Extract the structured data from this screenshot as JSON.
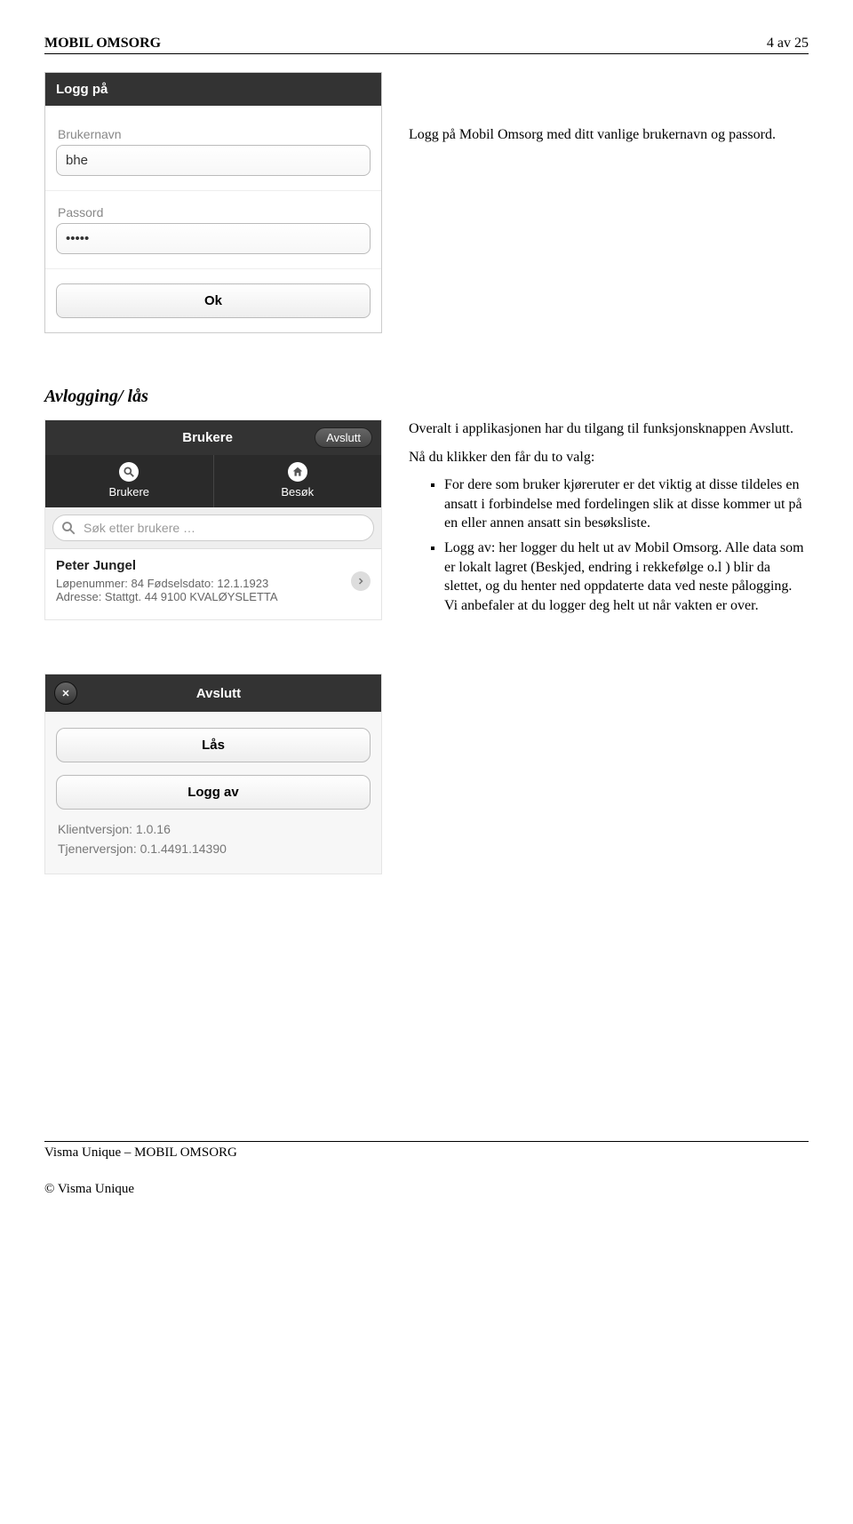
{
  "header": {
    "left": "MOBIL OMSORG",
    "right": "4 av 25"
  },
  "login": {
    "title": "Logg på",
    "username_label": "Brukernavn",
    "username_value": "bhe",
    "password_label": "Passord",
    "password_value": "•••••",
    "ok": "Ok"
  },
  "intro": {
    "text": "Logg på Mobil Omsorg med ditt vanlige brukernavn og passord."
  },
  "section2": {
    "title": "Avlogging/ lås",
    "para1": "Overalt i applikasjonen har du tilgang til funksjonsknappen Avslutt.",
    "para2": "Nå du klikker den får du to valg:",
    "bullet1": "For dere som bruker kjøreruter er det viktig at disse tildeles en ansatt i forbindelse med fordelingen slik at disse kommer ut på en eller annen ansatt sin besøksliste.",
    "bullet2": "Logg av: her logger du helt ut av Mobil Omsorg. Alle data som er lokalt lagret (Beskjed, endring i rekkefølge o.l ) blir da slettet, og du henter ned oppdaterte data ved neste pålogging. Vi anbefaler at du logger deg helt ut når vakten er over."
  },
  "brukere": {
    "title": "Brukere",
    "avslutt": "Avslutt",
    "tab_brukere": "Brukere",
    "tab_besok": "Besøk",
    "search_placeholder": "Søk etter brukere …",
    "user_name": "Peter Jungel",
    "line1": "Løpenummer: 84 Fødselsdato: 12.1.1923",
    "line2": "Adresse: Stattgt. 44 9100 KVALØYSLETTA"
  },
  "avslutt": {
    "title": "Avslutt",
    "lock": "Lås",
    "logout": "Logg av",
    "client_label": "Klientversjon: 1.0.16",
    "server_label": "Tjenerversjon: 0.1.4491.14390"
  },
  "footer": {
    "line1": "Visma Unique – MOBIL OMSORG",
    "copyright": "© Visma Unique"
  }
}
